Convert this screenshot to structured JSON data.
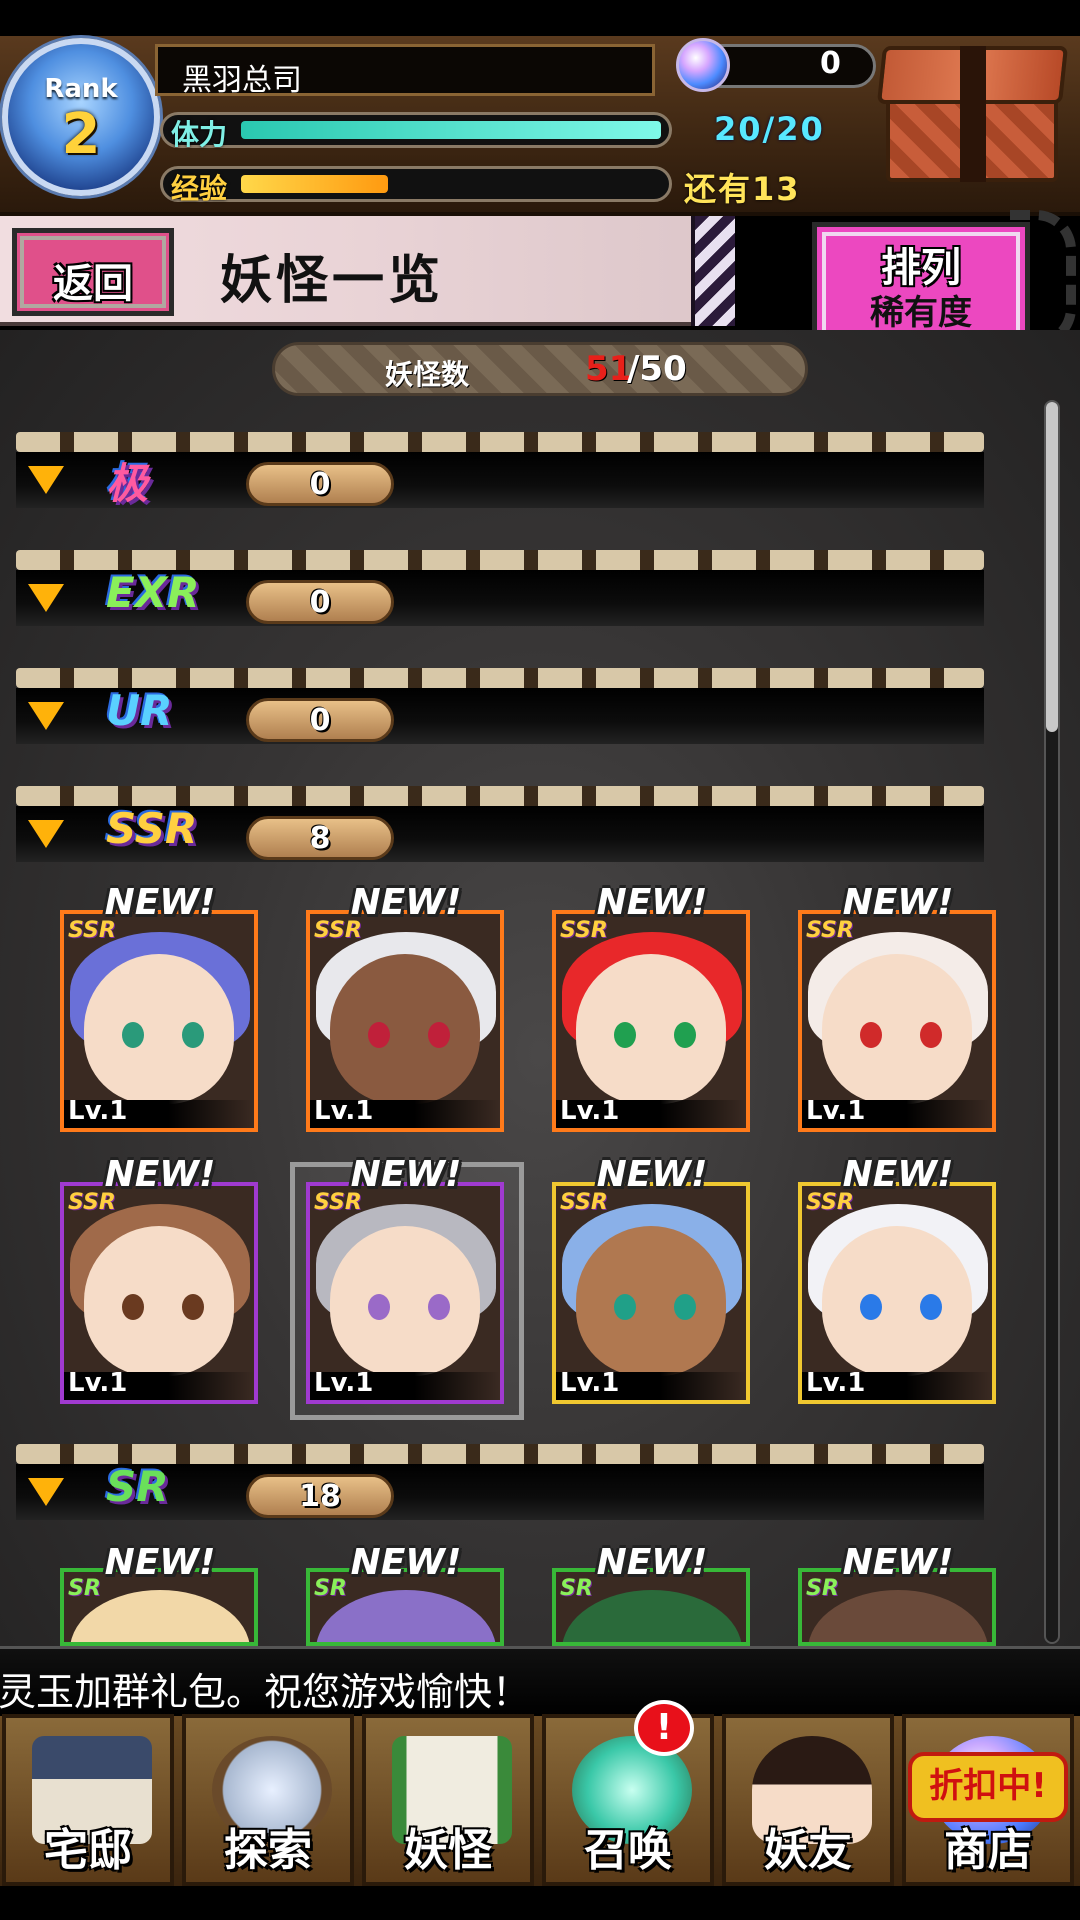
{
  "header": {
    "rank_label": "Rank",
    "rank_value": "2",
    "player_name": "黑羽总司",
    "orb_count": "0",
    "stamina_label": "体力",
    "stamina_value": "20/20",
    "stamina_fill": 1.0,
    "exp_label": "经验",
    "exp_remaining": "还有13",
    "exp_fill": 0.35,
    "colors": {
      "stamina": "#3fe0c8",
      "exp": "#ffb21a"
    }
  },
  "titlebar": {
    "back_label": "返回",
    "title": "妖怪一览",
    "sort_label": "排列",
    "sort_value": "稀有度"
  },
  "monster_count": {
    "label": "妖怪数",
    "current": "51",
    "max": "/50"
  },
  "categories": [
    {
      "rarity": "极",
      "count": "0"
    },
    {
      "rarity": "EXR",
      "count": "0"
    },
    {
      "rarity": "UR",
      "count": "0"
    },
    {
      "rarity": "SSR",
      "count": "8"
    },
    {
      "rarity": "SR",
      "count": "18"
    }
  ],
  "new_tag": "NEW!",
  "cards_ssr": [
    {
      "rarity": "SSR",
      "level": "Lv.1"
    },
    {
      "rarity": "SSR",
      "level": "Lv.1"
    },
    {
      "rarity": "SSR",
      "level": "Lv.1"
    },
    {
      "rarity": "SSR",
      "level": "Lv.1"
    },
    {
      "rarity": "SSR",
      "level": "Lv.1"
    },
    {
      "rarity": "SSR",
      "level": "Lv.1"
    },
    {
      "rarity": "SSR",
      "level": "Lv.1"
    },
    {
      "rarity": "SSR",
      "level": "Lv.1"
    }
  ],
  "cards_sr": [
    {
      "rarity": "SR"
    },
    {
      "rarity": "SR"
    },
    {
      "rarity": "SR"
    },
    {
      "rarity": "SR"
    }
  ],
  "ticker": "灵玉加群礼包。祝您游戏愉快！",
  "nav": [
    {
      "label": "宅邸",
      "icon": "mansion-icon"
    },
    {
      "label": "探索",
      "icon": "magnifier-map-icon"
    },
    {
      "label": "妖怪",
      "icon": "scroll-icon"
    },
    {
      "label": "召唤",
      "icon": "pentagram-icon"
    },
    {
      "label": "妖友",
      "icon": "fox-girl-icon"
    },
    {
      "label": "商店",
      "icon": "orb-shop-icon"
    }
  ],
  "nav_alert": "!",
  "shop_badge": "折扣中!"
}
